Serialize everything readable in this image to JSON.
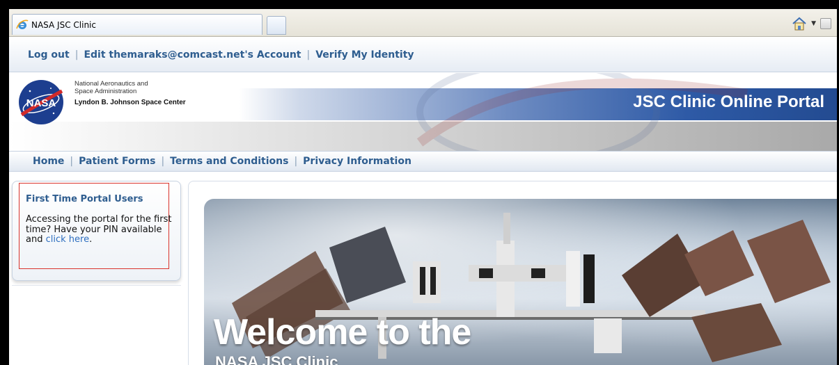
{
  "browser": {
    "tab_title": "NASA JSC Clinic"
  },
  "topbar": {
    "log_out": "Log out",
    "edit_account": "Edit themaraks@comcast.net's Account",
    "verify_identity": "Verify My Identity",
    "separator": "|"
  },
  "header": {
    "agency_line1": "National Aeronautics and",
    "agency_line2": "Space Administration",
    "center_name": "Lyndon B. Johnson Space Center",
    "portal_title": "JSC Clinic Online Portal",
    "logo_text": "NASA"
  },
  "nav": {
    "home": "Home",
    "patient_forms": "Patient Forms",
    "terms": "Terms and Conditions",
    "privacy": "Privacy Information",
    "separator": "|"
  },
  "sidebar": {
    "heading": "First Time Portal Users",
    "text": "Accessing the portal for the first time? Have your PIN available and ",
    "link": "click here",
    "end": "."
  },
  "hero": {
    "title": "Welcome to the",
    "subtitle": "NASA JSC Clinic"
  },
  "colors": {
    "link_blue": "#2e5d8f",
    "banner_blue": "#2e5aa6",
    "highlight_red": "#d9322b"
  }
}
